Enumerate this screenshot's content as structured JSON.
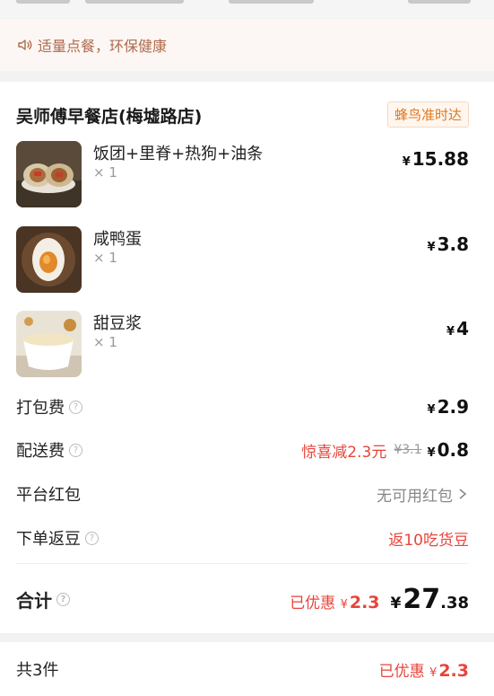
{
  "notice": {
    "icon": "speaker-icon",
    "text": "适量点餐，环保健康"
  },
  "shop": {
    "name": "吴师傅早餐店(梅墟路店)",
    "badge": "蜂鸟准时达"
  },
  "items": [
    {
      "name": "饭团+里脊+热狗+油条",
      "qty": "× 1",
      "currency": "¥",
      "price": "15.88"
    },
    {
      "name": "咸鸭蛋",
      "qty": "× 1",
      "currency": "¥",
      "price": "3.8"
    },
    {
      "name": "甜豆浆",
      "qty": "× 1",
      "currency": "¥",
      "price": "4"
    }
  ],
  "fees": {
    "packing": {
      "label": "打包费",
      "currency": "¥",
      "value": "2.9"
    },
    "delivery": {
      "label": "配送费",
      "promo": "惊喜减2.3元",
      "original": "¥3.1",
      "currency": "¥",
      "value": "0.8"
    },
    "redpacket": {
      "label": "平台红包",
      "value": "无可用红包",
      "chevron": "chevron-right-icon"
    },
    "beans": {
      "label": "下单返豆",
      "value": "返10吃货豆"
    }
  },
  "total": {
    "label": "合计",
    "saved_label": "已优惠",
    "saved_currency": "¥",
    "saved_value": "2.3",
    "currency": "¥",
    "integer": "27",
    "decimal": ".38"
  },
  "footer": {
    "count": "共3件",
    "saved_label": "已优惠",
    "saved_currency": "¥",
    "saved_value": "2.3"
  },
  "colors": {
    "accent_red": "#e8443a",
    "badge_orange": "#e0781f",
    "notice_brown": "#b06a4c"
  }
}
